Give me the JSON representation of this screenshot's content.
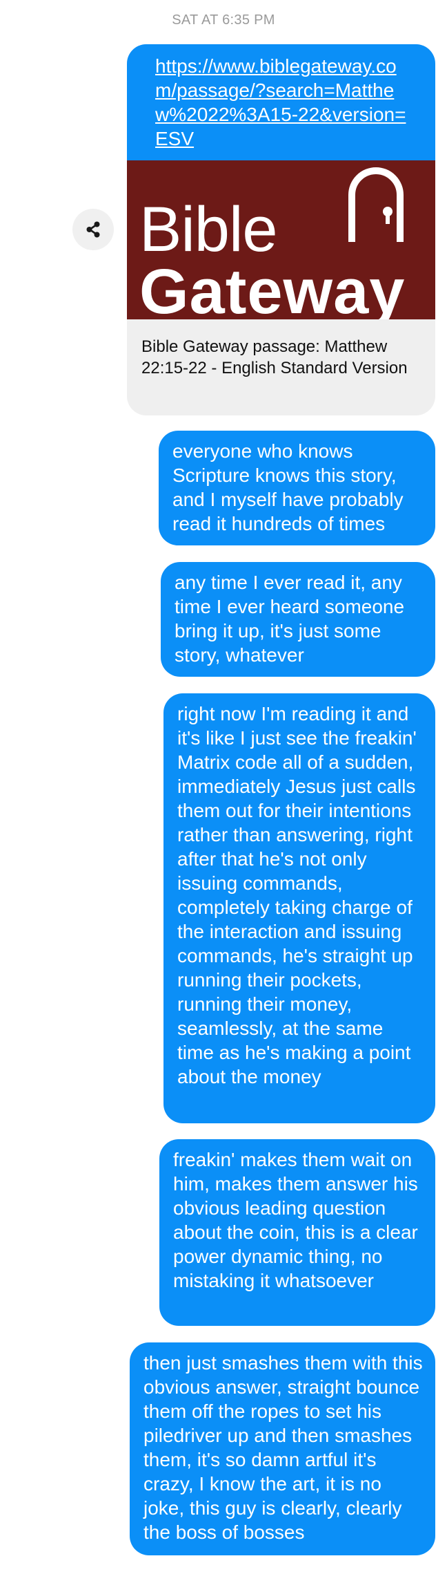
{
  "thread": {
    "timestamp": "SAT AT 6:35 PM"
  },
  "share_icon": "share-icon",
  "link_card": {
    "url": "https://www.biblegateway.com/passage/?search=Matthew%2022%3A15-22&version=ESV",
    "brand_line1": "Bible",
    "brand_line2": "Gateway",
    "title": "Bible Gateway passage: Matthew 22:15-22 - English Standard Version",
    "image_color": "#6d1a17"
  },
  "bubble_color": "#0b8ff7",
  "messages": [
    "everyone who knows Scripture knows this story, and I myself have probably read it hundreds of times",
    "any time I ever read it, any time I ever heard someone bring it up, it's just some story, whatever",
    "right now I'm reading it and it's like I just see the freakin' Matrix code all of a sudden, immediately Jesus just calls them out for their intentions rather than answering, right after that he's not only issuing commands, completely taking charge of the interaction and issuing commands, he's straight up running their pockets, running their money, seamlessly, at the same time as he's making a point about the money",
    "freakin' makes them wait on him, makes them answer his obvious leading question about the coin, this is a clear power dynamic thing, no mistaking it whatsoever",
    "then just smashes them with this obvious answer, straight bounce them off the ropes to set his piledriver up and then smashes them, it's so damn artful it's crazy, I know the art, it is no joke, this guy is clearly, clearly the boss of bosses"
  ]
}
